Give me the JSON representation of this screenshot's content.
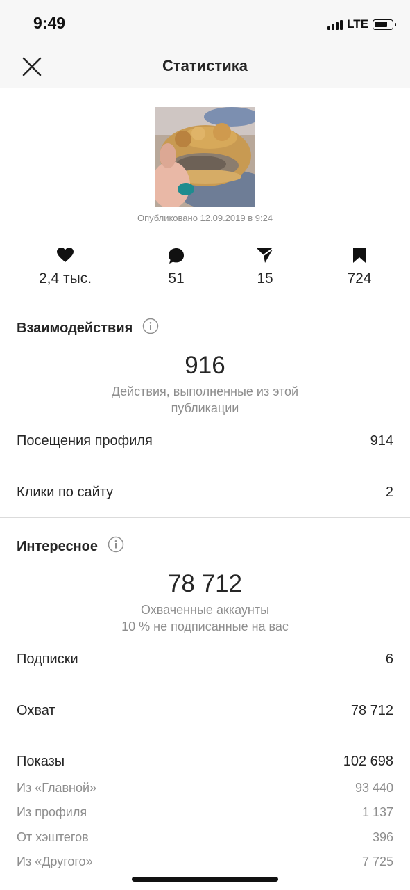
{
  "status_bar": {
    "time": "9:49",
    "network": "LTE"
  },
  "header": {
    "title": "Статистика"
  },
  "post": {
    "published": "Опубликовано 12.09.2019 в 9:24"
  },
  "metrics": [
    {
      "icon": "heart-icon",
      "value": "2,4 тыс."
    },
    {
      "icon": "comment-icon",
      "value": "51"
    },
    {
      "icon": "share-icon",
      "value": "15"
    },
    {
      "icon": "bookmark-icon",
      "value": "724"
    }
  ],
  "interactions": {
    "title": "Взаимодействия",
    "total": "916",
    "description_line1": "Действия, выполненные из этой",
    "description_line2": "публикации",
    "rows": [
      {
        "label": "Посещения профиля",
        "value": "914"
      },
      {
        "label": "Клики по сайту",
        "value": "2"
      }
    ]
  },
  "discovery": {
    "title": "Интересное",
    "total": "78 712",
    "description_line1": "Охваченные аккаунты",
    "description_line2": "10 % не подписанные на вас",
    "rows": [
      {
        "label": "Подписки",
        "value": "6"
      },
      {
        "label": "Охват",
        "value": "78 712"
      },
      {
        "label": "Показы",
        "value": "102 698"
      }
    ],
    "impressions_breakdown": [
      {
        "label": "Из «Главной»",
        "value": "93 440"
      },
      {
        "label": "Из профиля",
        "value": "1 137"
      },
      {
        "label": "От хэштегов",
        "value": "396"
      },
      {
        "label": "Из «Другого»",
        "value": "7 725"
      }
    ]
  },
  "colors": {
    "text": "#262626",
    "secondary": "#8e8e8e",
    "divider": "#dbdbdb",
    "bar": "#f7f7f7"
  }
}
